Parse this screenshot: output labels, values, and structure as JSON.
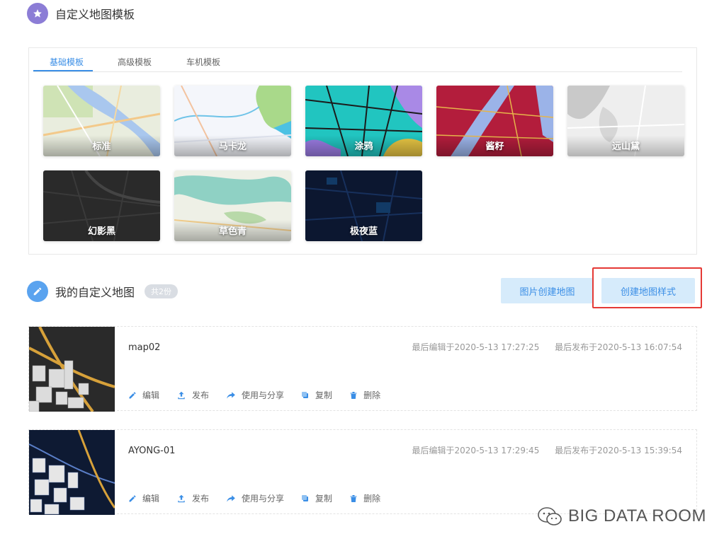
{
  "templates_section": {
    "title": "自定义地图模板",
    "tabs": [
      "基础模板",
      "高级模板",
      "车机模板"
    ],
    "active_tab": 0,
    "items": [
      "标准",
      "马卡龙",
      "涂鸦",
      "酱籽",
      "远山黛",
      "幻影黑",
      "草色青",
      "极夜蓝"
    ]
  },
  "my_maps": {
    "title": "我的自定义地图",
    "count_badge": "共2份",
    "image_create_button": "图片创建地图",
    "create_style_button": "创建地图样式",
    "maps": [
      {
        "name": "map02",
        "last_edit": "最后编辑于2020-5-13 17:27:25",
        "last_publish": "最后发布于2020-5-13 16:07:54"
      },
      {
        "name": "AYONG-01",
        "last_edit": "最后编辑于2020-5-13 17:29:45",
        "last_publish": "最后发布于2020-5-13 15:39:54"
      }
    ],
    "actions": [
      "编辑",
      "发布",
      "使用与分享",
      "复制",
      "删除"
    ]
  },
  "watermark": "BIG DATA ROOM",
  "colors": {
    "accent": "#3a8ee6",
    "button_bg": "#d6ebfb",
    "highlight_border": "#e53935",
    "template_icon": "#8c7dd6",
    "my_maps_icon": "#5aa3ef"
  },
  "icons": {
    "templates_header": "star-icon",
    "my_maps_header": "pencil-icon",
    "actions": [
      "pencil-icon",
      "upload-icon",
      "share-icon",
      "copy-icon",
      "trash-icon"
    ]
  }
}
